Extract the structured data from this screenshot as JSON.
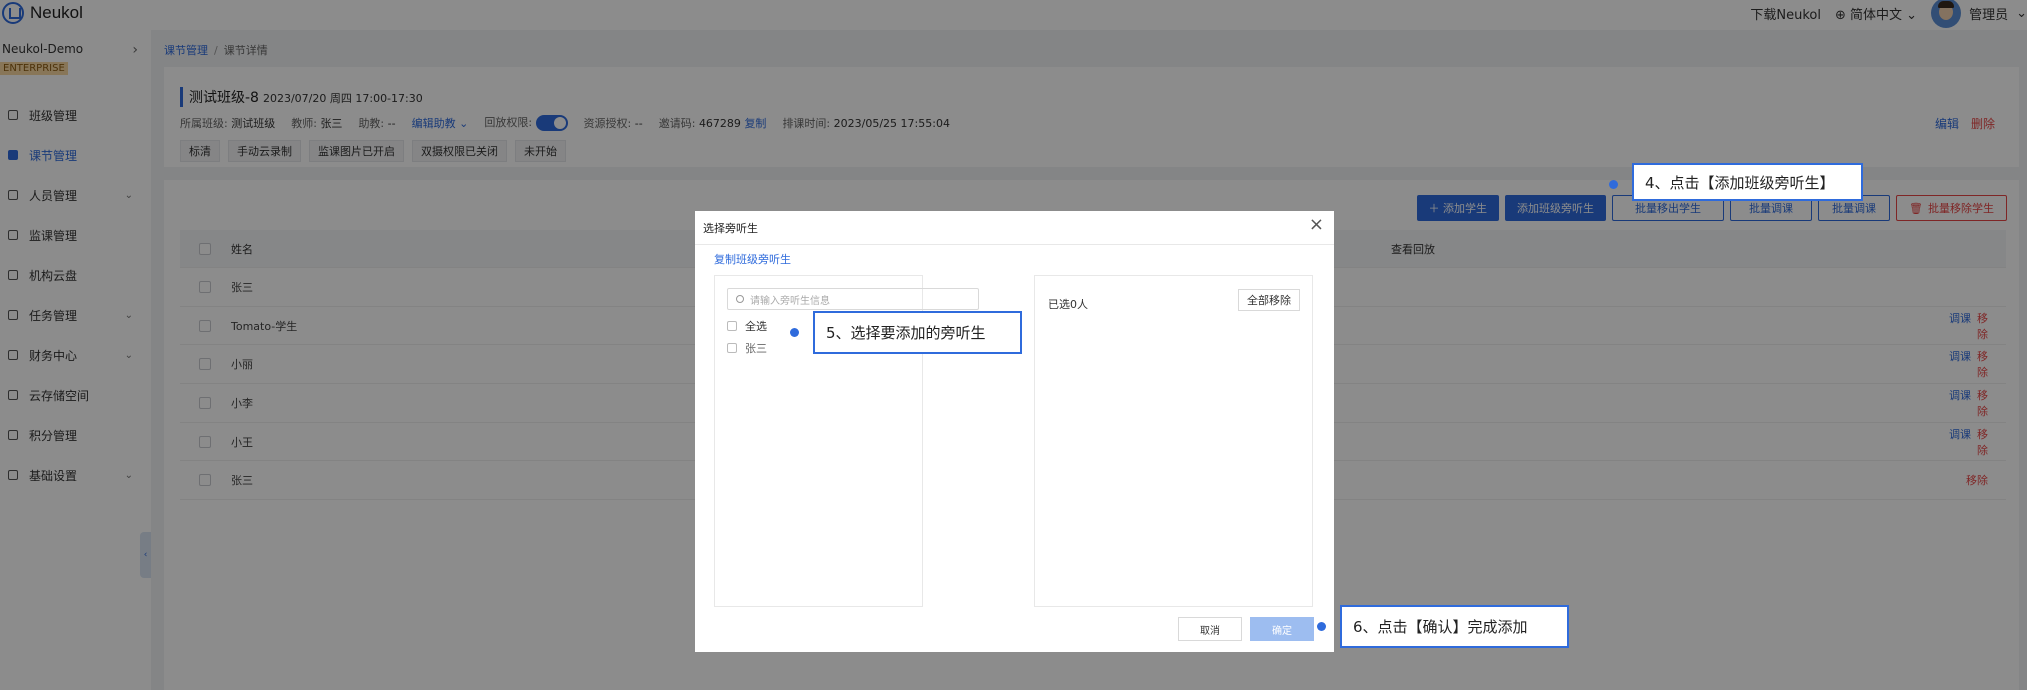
{
  "app": {
    "name": "Neukol"
  },
  "topbar": {
    "download": "下载Neukol",
    "language": "简体中文",
    "user": "管理员"
  },
  "sidebar": {
    "org_name": "Neukol-Demo",
    "org_badge": "ENTERPRISE",
    "items": [
      {
        "label": "班级管理",
        "icon": "class-icon",
        "active": false,
        "has_arrow": false
      },
      {
        "label": "课节管理",
        "icon": "lesson-icon",
        "active": true,
        "has_arrow": false
      },
      {
        "label": "人员管理",
        "icon": "people-icon",
        "active": false,
        "has_arrow": true
      },
      {
        "label": "监课管理",
        "icon": "monitor-icon",
        "active": false,
        "has_arrow": false
      },
      {
        "label": "机构云盘",
        "icon": "cloud-icon",
        "active": false,
        "has_arrow": false
      },
      {
        "label": "任务管理",
        "icon": "task-icon",
        "active": false,
        "has_arrow": true
      },
      {
        "label": "财务中心",
        "icon": "finance-icon",
        "active": false,
        "has_arrow": true
      },
      {
        "label": "云存储空间",
        "icon": "storage-icon",
        "active": false,
        "has_arrow": false
      },
      {
        "label": "积分管理",
        "icon": "points-icon",
        "active": false,
        "has_arrow": false
      },
      {
        "label": "基础设置",
        "icon": "settings-icon",
        "active": false,
        "has_arrow": true
      }
    ]
  },
  "breadcrumb": {
    "parent": "课节管理",
    "sep": "/",
    "current": "课节详情"
  },
  "lesson": {
    "title": "测试班级-8",
    "time": "2023/07/20 周四 17:00-17:30",
    "class_label": "所属班级:",
    "class_value": "测试班级",
    "teacher_label": "教师:",
    "teacher_value": "张三",
    "assistant_label": "助教:",
    "assistant_value": "--",
    "edit_assistant": "编辑助教",
    "playback_label": "回放权限:",
    "resource_label": "资源授权:",
    "resource_value": "--",
    "invite_label": "邀请码:",
    "invite_value": "467289",
    "copy_label": "复制",
    "schedule_label": "排课时间:",
    "schedule_value": "2023/05/25 17:55:04",
    "tags": [
      "标清",
      "手动云录制",
      "监课图片已开启",
      "双摄权限已关闭",
      "未开始"
    ],
    "edit": "编辑",
    "delete": "删除"
  },
  "toolbar": {
    "add_student": "＋ 添加学生",
    "add_auditor": "添加班级旁听生",
    "hidden1": "批量移出学生",
    "hidden2": "批量调课",
    "hidden3": "批量调课",
    "batch_remove": "批量移除学生"
  },
  "table": {
    "col_name": "姓名",
    "col_playback": "查看回放",
    "rows": [
      {
        "name": "张三",
        "ops": []
      },
      {
        "name": "Tomato-学生",
        "ops": [
          "调课",
          "移除"
        ]
      },
      {
        "name": "小丽",
        "ops": [
          "调课",
          "移除"
        ]
      },
      {
        "name": "小李",
        "ops": [
          "调课",
          "移除"
        ]
      },
      {
        "name": "小王",
        "ops": [
          "调课",
          "移除"
        ]
      },
      {
        "name": "张三",
        "ops": [
          "移除"
        ]
      }
    ]
  },
  "modal": {
    "title": "选择旁听生",
    "copy_link": "复制班级旁听生",
    "search_placeholder": "请输入旁听生信息",
    "select_all": "全选",
    "options": [
      "张三"
    ],
    "selected": "已选0人",
    "remove_all": "全部移除",
    "cancel": "取消",
    "ok": "确定"
  },
  "callouts": {
    "step4": "4、点击【添加班级旁听生】",
    "step5": "5、选择要添加的旁听生",
    "step6": "6、点击【确认】完成添加"
  },
  "colors": {
    "accent": "#2f6bdc",
    "danger": "#e84545"
  }
}
